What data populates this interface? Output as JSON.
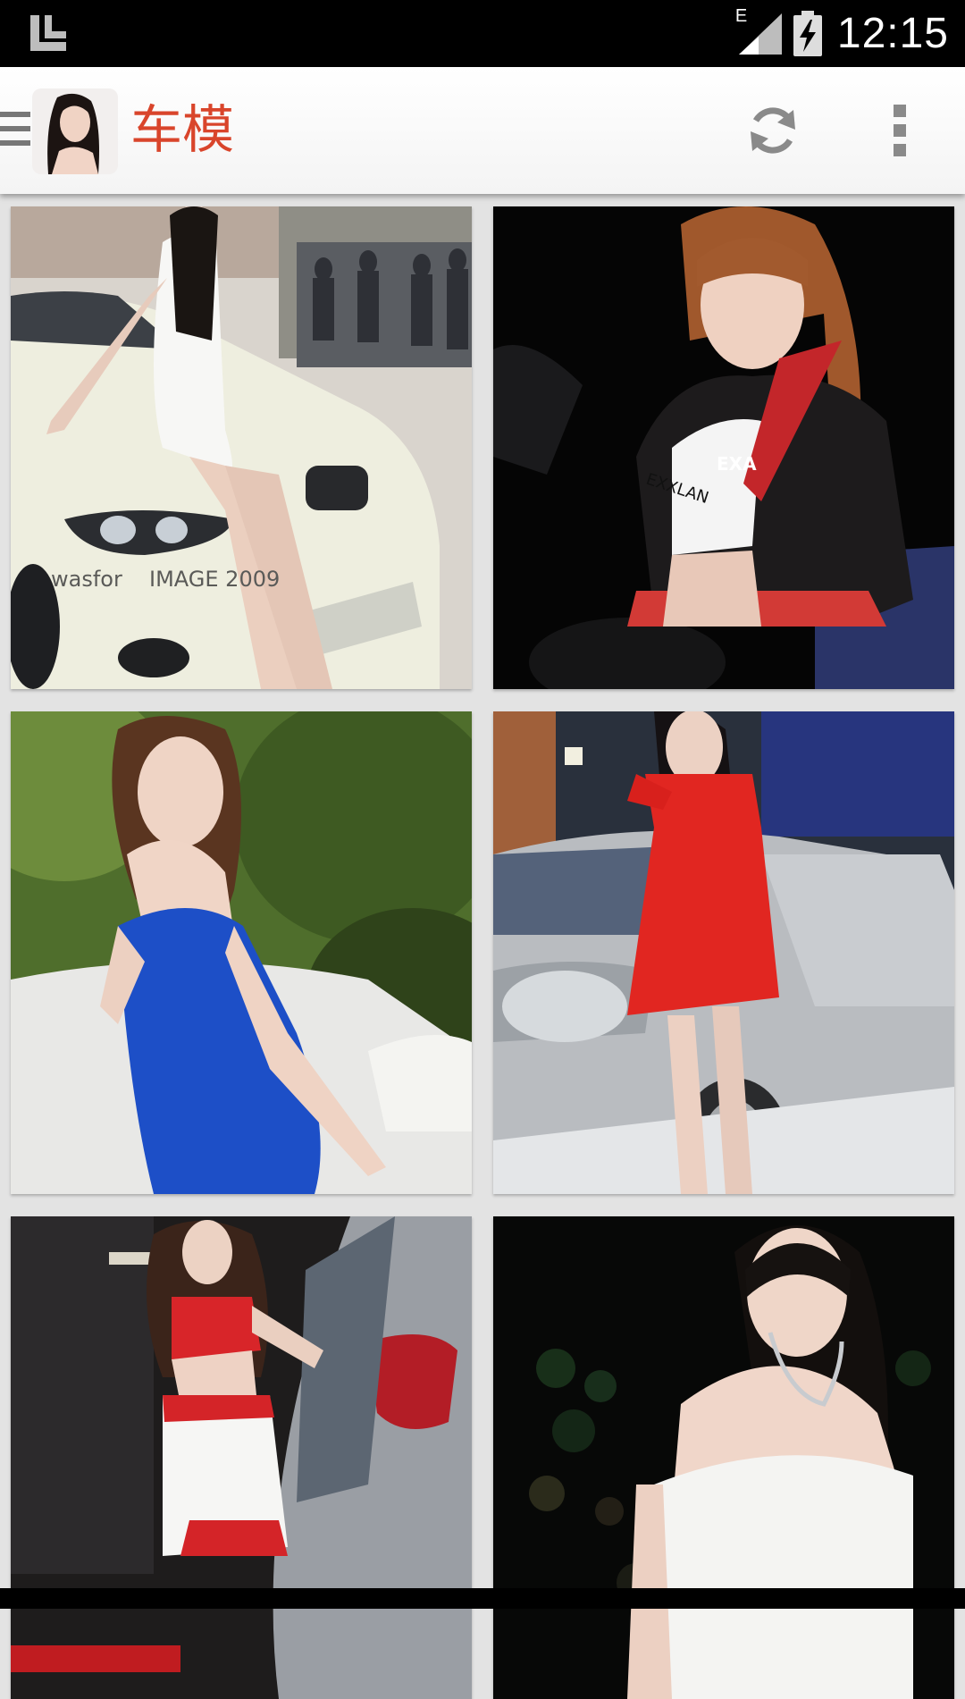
{
  "status_bar": {
    "time": "12:15",
    "network_type": "E"
  },
  "app_bar": {
    "title": "车模"
  },
  "photos": [
    {
      "watermark_left": "wasfor",
      "watermark_right": "IMAGE 2009"
    },
    {
      "shirt_text": "EXA",
      "top_text": "EXXLAN"
    },
    {},
    {},
    {},
    {}
  ],
  "colors": {
    "title": "#d9452b",
    "status_bar": "#000000",
    "grid_background": "#e3e3e3"
  }
}
